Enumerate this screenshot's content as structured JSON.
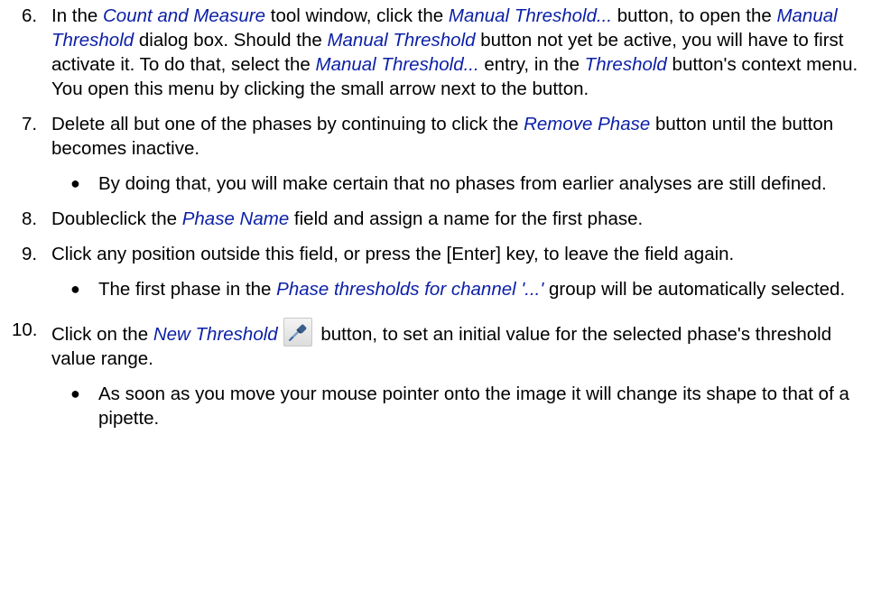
{
  "steps": {
    "s6": {
      "num": "6.",
      "t1": "In the ",
      "u1": "Count and Measure",
      "t2": " tool window, click the ",
      "u2": "Manual Threshold...",
      "t3": " button, to open the ",
      "u3": "Manual Threshold",
      "t4": " dialog box.  Should the ",
      "u4": "Manual Threshold",
      "t5": " button not yet be active, you will have to first activate it. To do that, select the ",
      "u5": "Manual Threshold...",
      "t6": " entry, in the ",
      "u6": "Threshold",
      "t7": " button's context menu. You open this menu by clicking the small arrow next to the button."
    },
    "s7": {
      "num": "7.",
      "t1": "Delete all but one of the phases by continuing to click the ",
      "u1": "Remove Phase",
      "t2": " button until the button becomes inactive.",
      "bullet": "By doing that, you will make certain that no phases from earlier analyses are still defined."
    },
    "s8": {
      "num": "8.",
      "t1": "Doubleclick the ",
      "u1": "Phase Name",
      "t2": " field and assign a name for the first phase."
    },
    "s9": {
      "num": "9.",
      "t1": "Click any position outside this field, or press the [Enter] key, to leave the field again.",
      "b_t1": "The first phase in the ",
      "b_u1": "Phase thresholds for channel '...'",
      "b_t2": " group will be automatically selected."
    },
    "s10": {
      "num": "10.",
      "t1": "Click on the ",
      "u1": "New Threshold",
      "icon": "pipette-icon",
      "t2": " button, to set an initial value for the selected phase's threshold value range.",
      "bullet": "As soon as you move your mouse pointer onto the image it will change its shape to that of a pipette."
    }
  },
  "colors": {
    "ui_reference": "#0b1fa6",
    "text": "#000000",
    "background": "#ffffff"
  }
}
